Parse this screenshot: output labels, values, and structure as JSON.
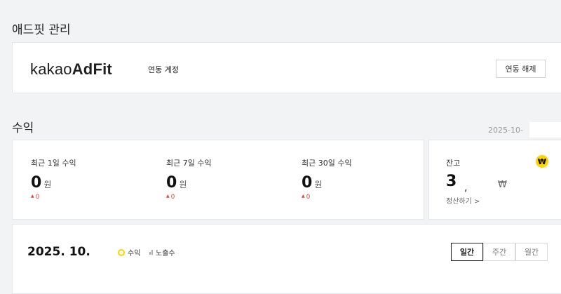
{
  "page_title": "애드핏 관리",
  "account": {
    "logo_prefix": "kakao",
    "logo_brand": "AdFit",
    "status": "연동 계정",
    "unlink_button": "연동 해제"
  },
  "revenue": {
    "title": "수익",
    "date": "2025-10-",
    "stats": [
      {
        "label": "최근 1일 수익",
        "value": "0",
        "unit": "원",
        "change": "0"
      },
      {
        "label": "최근 7일 수익",
        "value": "0",
        "unit": "원",
        "change": "0"
      },
      {
        "label": "최근 30일 수익",
        "value": "0",
        "unit": "원",
        "change": "0"
      }
    ],
    "balance": {
      "label": "잔고",
      "value_partial": "3",
      "separator": ",",
      "currency": "₩",
      "coin_symbol": "₩",
      "settle_link": "정산하기 >"
    }
  },
  "chart_panel": {
    "date": "2025. 10.",
    "legend": [
      {
        "label": "수익",
        "icon": "ring-icon",
        "color": "#ffd400"
      },
      {
        "label": "노출수",
        "icon": "bar-chart-icon",
        "color": "#aaaaaa"
      }
    ],
    "period_tabs": [
      "일간",
      "주간",
      "월간"
    ],
    "active_tab": "일간"
  }
}
